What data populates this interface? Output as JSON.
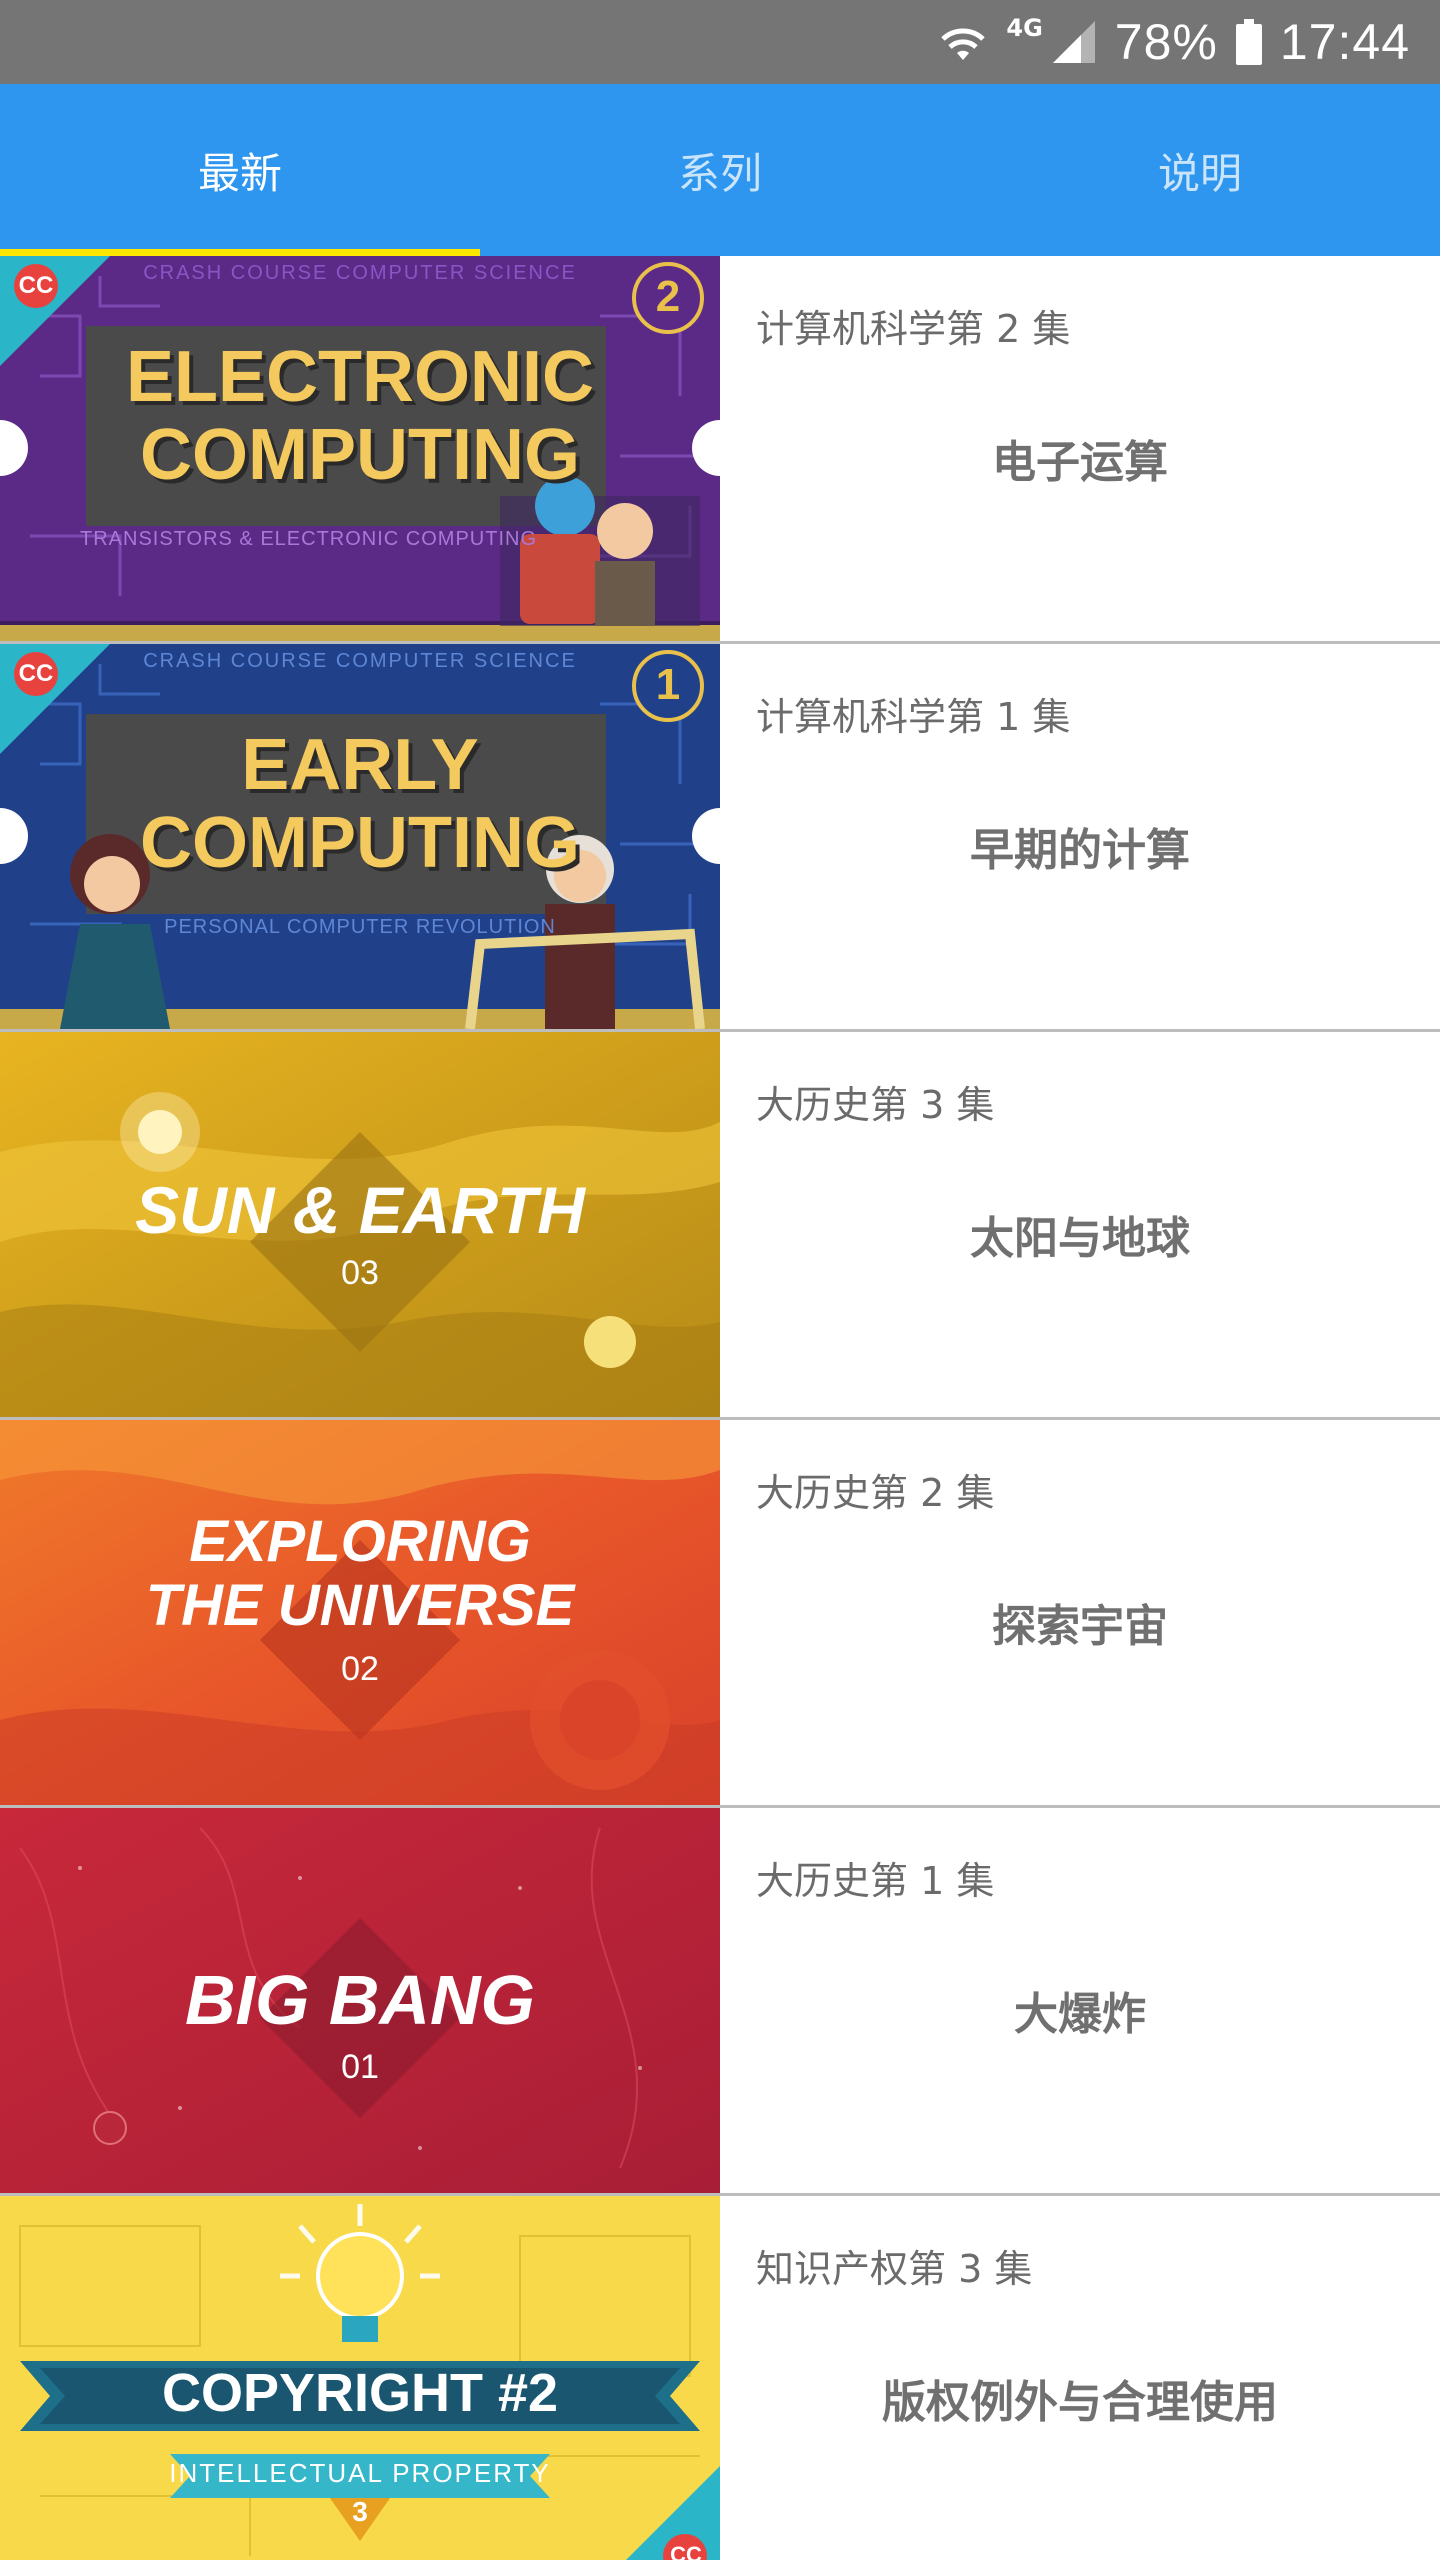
{
  "status_bar": {
    "network": "4G",
    "battery": "78%",
    "time": "17:44"
  },
  "tabs": [
    {
      "label": "最新",
      "active": true
    },
    {
      "label": "系列",
      "active": false
    },
    {
      "label": "说明",
      "active": false
    }
  ],
  "colors": {
    "status_bar": "#757575",
    "app_bar": "#2e96ee",
    "tab_indicator": "#ffe600"
  },
  "episodes": [
    {
      "subtitle": "计算机科学第 2 集",
      "title": "电子运算",
      "thumb": {
        "series_header": "CRASH COURSE COMPUTER SCIENCE",
        "line1": "ELECTRONIC",
        "line2": "COMPUTING",
        "caption": "TRANSISTORS & ELECTRONIC COMPUTING",
        "badge": "2",
        "logo": "CC"
      }
    },
    {
      "subtitle": "计算机科学第 1 集",
      "title": "早期的计算",
      "thumb": {
        "series_header": "CRASH COURSE COMPUTER SCIENCE",
        "line1": "EARLY",
        "line2": "COMPUTING",
        "caption": "PERSONAL COMPUTER REVOLUTION",
        "badge": "1",
        "logo": "CC"
      }
    },
    {
      "subtitle": "大历史第 3 集",
      "title": "太阳与地球",
      "thumb": {
        "line1": "SUN & EARTH",
        "number": "03"
      }
    },
    {
      "subtitle": "大历史第 2 集",
      "title": "探索宇宙",
      "thumb": {
        "line1": "EXPLORING",
        "line2": "THE UNIVERSE",
        "number": "02"
      }
    },
    {
      "subtitle": "大历史第 1 集",
      "title": "大爆炸",
      "thumb": {
        "line1": "BIG BANG",
        "number": "01"
      }
    },
    {
      "subtitle": "知识产权第 3 集",
      "title": "版权例外与合理使用",
      "thumb": {
        "line1": "COPYRIGHT #2",
        "banner": "INTELLECTUAL PROPERTY",
        "number": "3",
        "logo": "CC"
      }
    }
  ]
}
